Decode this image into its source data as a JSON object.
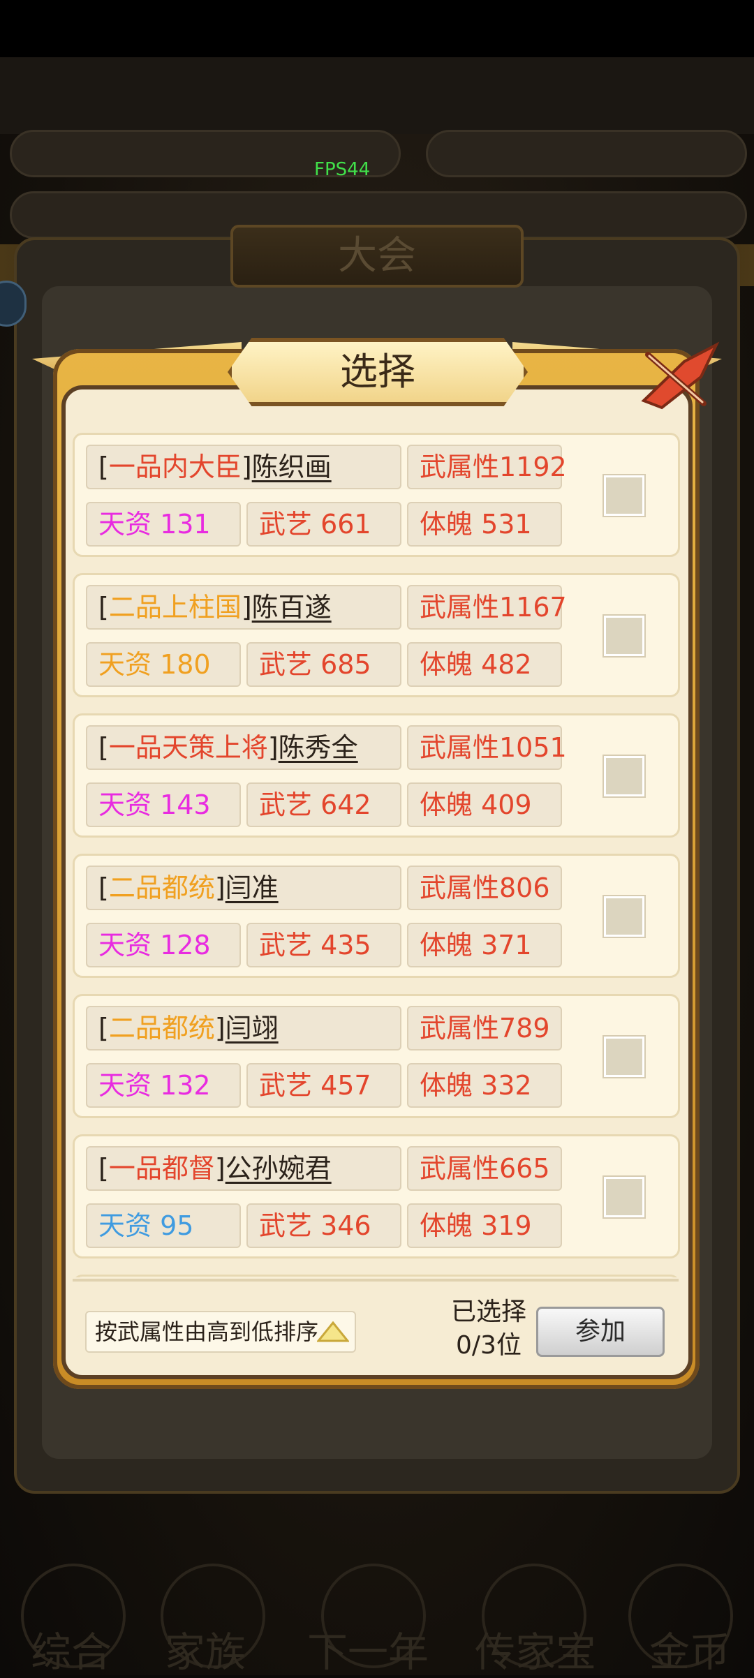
{
  "fps": "FPS44",
  "background": {
    "title": "大会",
    "nav_labels": [
      "综合",
      "家族",
      "下一年",
      "传家宝",
      "金币"
    ]
  },
  "dialog": {
    "title": "选择",
    "rows": [
      {
        "rank": "一品内大臣",
        "rank_color": "#e3452c",
        "name": "陈织画",
        "attr": "武属性1192",
        "talent": "天资 131",
        "talent_color": "#e82be0",
        "martial": "武艺 661",
        "physique": "体魄 531"
      },
      {
        "rank": "二品上柱国",
        "rank_color": "#f0a020",
        "name": "陈百遂",
        "attr": "武属性1167",
        "talent": "天资 180",
        "talent_color": "#f0a020",
        "martial": "武艺 685",
        "physique": "体魄 482"
      },
      {
        "rank": "一品天策上将",
        "rank_color": "#e3452c",
        "name": "陈秀全",
        "attr": "武属性1051",
        "talent": "天资 143",
        "talent_color": "#e82be0",
        "martial": "武艺 642",
        "physique": "体魄 409"
      },
      {
        "rank": "二品都统",
        "rank_color": "#f0a020",
        "name": "闫准",
        "attr": "武属性806",
        "talent": "天资 128",
        "talent_color": "#e82be0",
        "martial": "武艺 435",
        "physique": "体魄 371"
      },
      {
        "rank": "二品都统",
        "rank_color": "#f0a020",
        "name": "闫翊",
        "attr": "武属性789",
        "talent": "天资 132",
        "talent_color": "#e82be0",
        "martial": "武艺 457",
        "physique": "体魄 332"
      },
      {
        "rank": "一品都督",
        "rank_color": "#e3452c",
        "name": "公孙婉君",
        "attr": "武属性665",
        "talent": "天资 95",
        "talent_color": "#3f9be0",
        "martial": "武艺 346",
        "physique": "体魄 319"
      }
    ],
    "sort_label": "按武属性由高到低排序",
    "selected_label": "已选择",
    "selected_count": "0/3位",
    "join_label": "参加"
  }
}
